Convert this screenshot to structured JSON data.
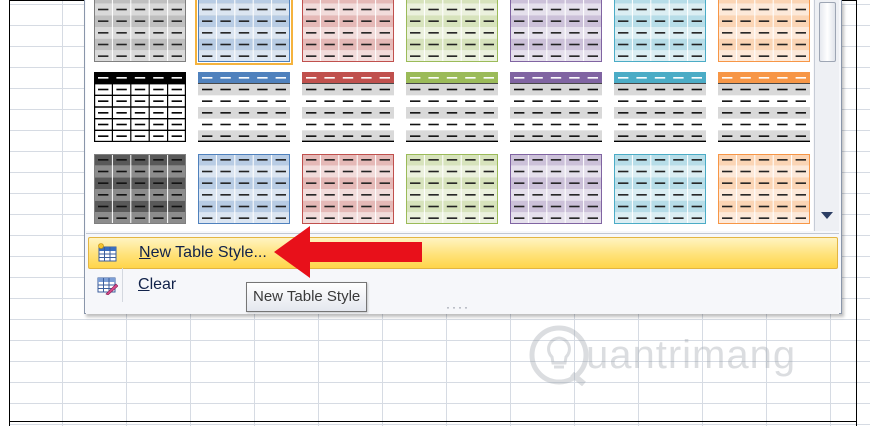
{
  "menu": {
    "new_table_style": {
      "prefix": "",
      "underlined": "N",
      "rest": "ew Table Style..."
    },
    "clear": {
      "underlined": "C",
      "rest": "lear"
    }
  },
  "tooltip": {
    "text": "New Table Style"
  },
  "grip": {
    "text": "····"
  },
  "watermark": {
    "text": "uantrimang"
  },
  "icons": {
    "new_style": "table-style-new-icon",
    "clear": "table-style-clear-icon",
    "arrow": "red-arrow-annotation",
    "scroll_down": "scroll-down-arrow-icon"
  },
  "colors": {
    "accent_highlight": "#ffd54a",
    "arrow": "#e8101a",
    "styles": [
      "#7f7f7f",
      "#4f81bd",
      "#c0504d",
      "#9bbb59",
      "#8064a2",
      "#4bacc6",
      "#f79646"
    ],
    "styles_light": [
      "#d9d9d9",
      "#dbe5f1",
      "#f2dcdb",
      "#ebf1dd",
      "#e5e0ec",
      "#dbeef3",
      "#fde9d9"
    ],
    "styles_mid": [
      "#bfbfbf",
      "#b8cce4",
      "#e5b9b7",
      "#d7e3bc",
      "#ccc1d9",
      "#b7dde8",
      "#fbd5b5"
    ]
  }
}
